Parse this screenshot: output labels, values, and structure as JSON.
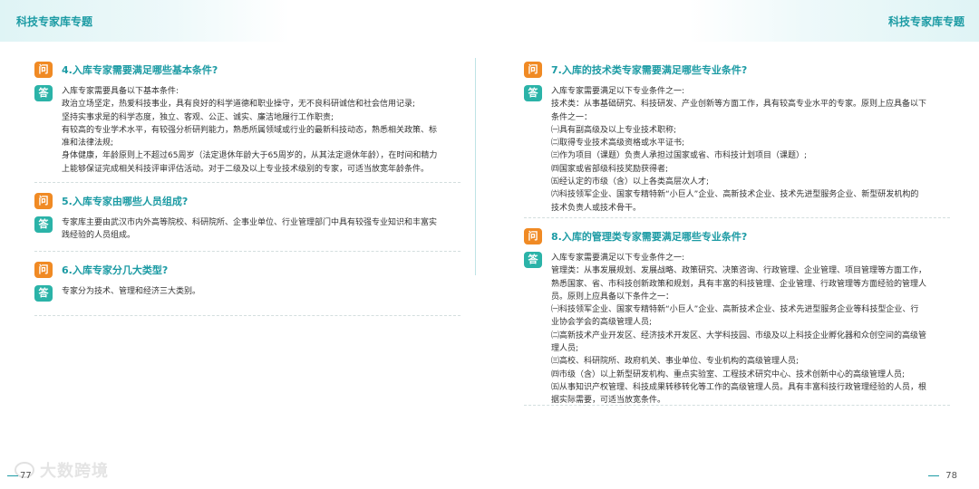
{
  "header": {
    "left_title": "科技专家库专题",
    "right_title": "科技专家库专题"
  },
  "badges": {
    "question": "问",
    "answer": "答"
  },
  "left_column": [
    {
      "question": "4.入库专家需要满足哪些基本条件?",
      "answer_lines": [
        "入库专家需要具备以下基本条件:",
        "政治立场坚定，热爱科技事业，具有良好的科学道德和职业操守，无不良科研诚信和社会信用记录;",
        "坚持实事求是的科学态度，独立、客观、公正、诚实、廉洁地履行工作职责;",
        "有较高的专业学术水平，有较强分析研判能力，熟悉所属领域或行业的最新科技动态，熟悉相关政策、标",
        "准和法律法规;",
        "身体健康，年龄原则上不超过65周岁（法定退休年龄大于65周岁的，从其法定退休年龄），在时间和精力",
        "上能够保证完成相关科技评审评估活动。对于二级及以上专业技术级别的专家，可适当放宽年龄条件。"
      ]
    },
    {
      "question": "5.入库专家由哪些人员组成?",
      "answer_lines": [
        "专家库主要由武汉市内外高等院校、科研院所、企事业单位、行业管理部门中具有较强专业知识和丰富实",
        "践经验的人员组成。"
      ]
    },
    {
      "question": "6.入库专家分几大类型?",
      "answer_lines": [
        "专家分为技术、管理和经济三大类别。"
      ]
    }
  ],
  "right_column": [
    {
      "question": "7.入库的技术类专家需要满足哪些专业条件?",
      "answer_lines": [
        "入库专家需要满足以下专业条件之一:",
        "技术类：从事基础研究、科技研发、产业创新等方面工作，具有较高专业水平的专家。原则上应具备以下",
        "条件之一：",
        "㈠具有副高级及以上专业技术职称;",
        "㈡取得专业技术高级资格或水平证书;",
        "㈢作为项目（课题）负责人承担过国家或省、市科技计划项目（课题）;",
        "㈣国家或省部级科技奖励获得者;",
        "㈤经认定的市级（含）以上各类高层次人才;",
        "㈥科技领军企业、国家专精特新“小巨人”企业、高新技术企业、技术先进型服务企业、新型研发机构的",
        "技术负责人或技术骨干。"
      ]
    },
    {
      "question": "8.入库的管理类专家需要满足哪些专业条件?",
      "answer_lines": [
        "入库专家需要满足以下专业条件之一:",
        "管理类：从事发展规划、发展战略、政策研究、决策咨询、行政管理、企业管理、项目管理等方面工作，",
        "熟悉国家、省、市科技创新政策和规划，具有丰富的科技管理、企业管理、行政管理等方面经验的管理人",
        "员。原则上应具备以下条件之一：",
        "㈠科技领军企业、国家专精特新“小巨人”企业、高新技术企业、技术先进型服务企业等科技型企业、行",
        "业协会学会的高级管理人员;",
        "㈡高新技术产业开发区、经济技术开发区、大学科技园、市级及以上科技企业孵化器和众创空间的高级管",
        "理人员;",
        "㈢高校、科研院所、政府机关、事业单位、专业机构的高级管理人员;",
        "㈣市级（含）以上新型研发机构、重点实验室、工程技术研究中心、技术创新中心的高级管理人员;",
        "㈤从事知识产权管理、科技成果转移转化等工作的高级管理人员。具有丰富科技行政管理经验的人员，根",
        "据实际需要，可适当放宽条件。"
      ]
    }
  ],
  "footer": {
    "left_page": "77",
    "right_page": "78",
    "watermark": "大数跨境"
  },
  "colors": {
    "accent": "#1c9ba4",
    "question_badge": "#f08a24",
    "answer_badge": "#2bb3a8"
  }
}
